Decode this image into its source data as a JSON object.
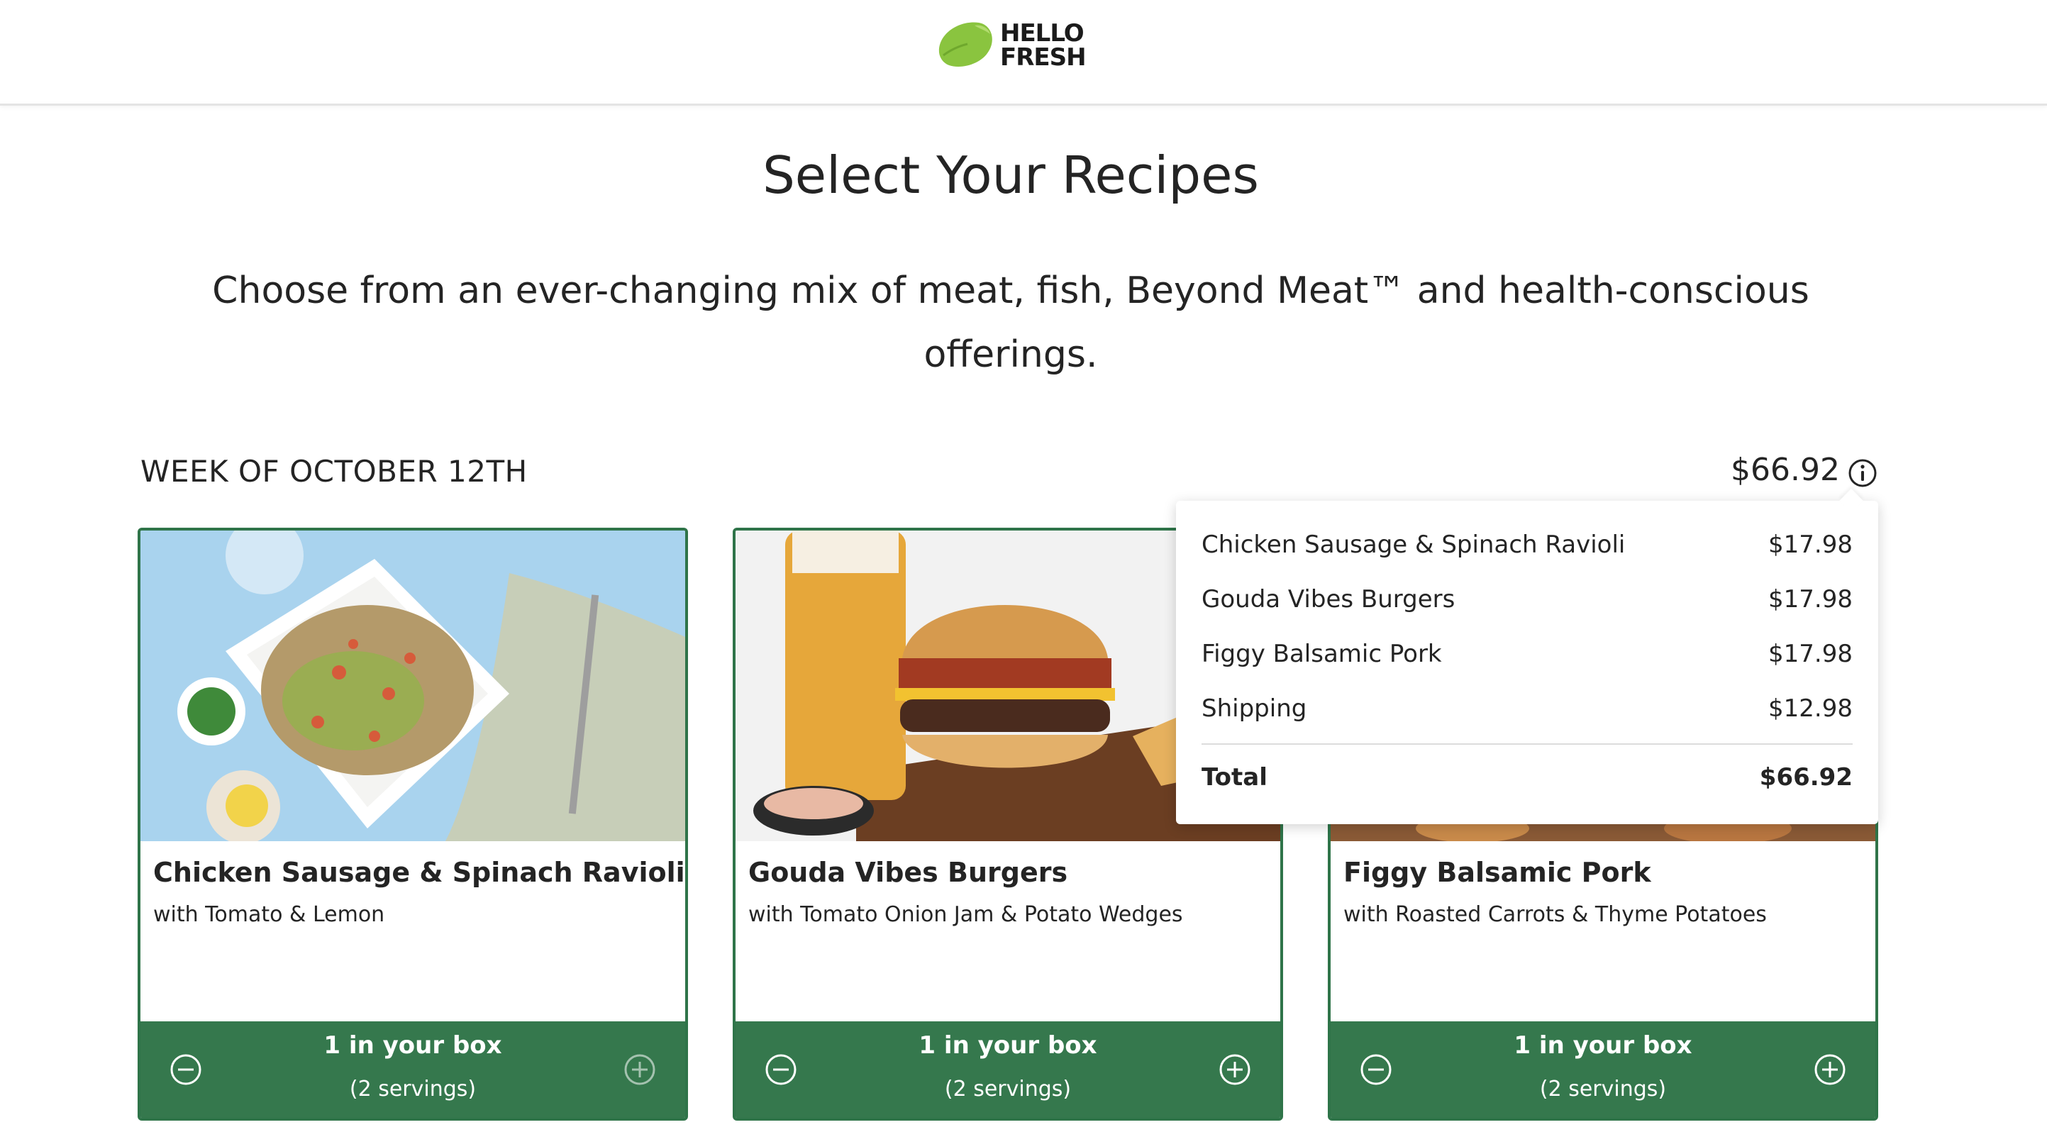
{
  "brand": {
    "line1": "HELLO",
    "line2": "FRESH",
    "lime": "#8ac43f",
    "dark": "#1b1b1b"
  },
  "header": {
    "title": "Select Your Recipes",
    "subtitle": "Choose from an ever-changing mix of meat, fish, Beyond Meat™ and health-conscious offerings."
  },
  "week": {
    "label": "WEEK OF OCTOBER 12TH",
    "total": "$66.92"
  },
  "colors": {
    "accent_green": "#35784d",
    "card_border": "#2f7449"
  },
  "recipes": [
    {
      "title": "Chicken Sausage & Spinach Ravioli",
      "subtitle": "with Tomato & Lemon",
      "quantity": "1 in your box",
      "servings": "(2 servings)",
      "image_icon": "ravioli-plate-photo"
    },
    {
      "title": "Gouda Vibes Burgers",
      "subtitle": "with Tomato Onion Jam & Potato Wedges",
      "quantity": "1 in your box",
      "servings": "(2 servings)",
      "image_icon": "burger-photo"
    },
    {
      "title": "Figgy Balsamic Pork",
      "subtitle": "with Roasted Carrots & Thyme Potatoes",
      "quantity": "1 in your box",
      "servings": "(2 servings)",
      "image_icon": "pork-dish-photo"
    }
  ],
  "price_breakdown": {
    "items": [
      {
        "name": "Chicken Sausage & Spinach Ravioli",
        "price": "$17.98"
      },
      {
        "name": "Gouda Vibes Burgers",
        "price": "$17.98"
      },
      {
        "name": "Figgy Balsamic Pork",
        "price": "$17.98"
      },
      {
        "name": "Shipping",
        "price": "$12.98"
      }
    ],
    "total_label": "Total",
    "total_value": "$66.92"
  }
}
